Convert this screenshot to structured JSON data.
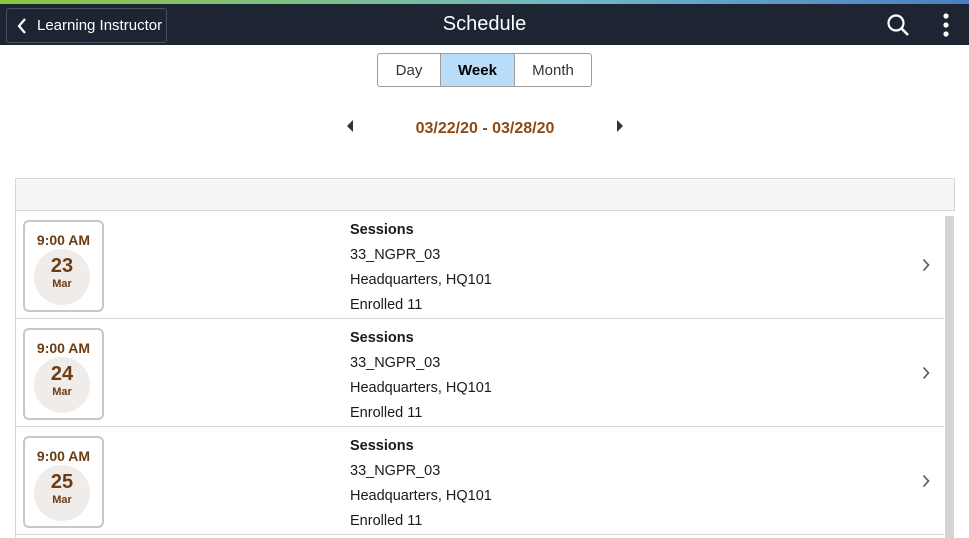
{
  "header": {
    "back_label": "Learning Instructor",
    "title": "Schedule"
  },
  "view_toggle": {
    "day": "Day",
    "week": "Week",
    "month": "Month",
    "selected": "Week"
  },
  "date_range": "03/22/20 - 03/28/20",
  "sessions": [
    {
      "time": "9:00 AM",
      "day": "23",
      "month": "Mar",
      "type": "Sessions",
      "code": "33_NGPR_03",
      "location": "Headquarters, HQ101",
      "enrolled": "Enrolled 11"
    },
    {
      "time": "9:00 AM",
      "day": "24",
      "month": "Mar",
      "type": "Sessions",
      "code": "33_NGPR_03",
      "location": "Headquarters, HQ101",
      "enrolled": "Enrolled 11"
    },
    {
      "time": "9:00 AM",
      "day": "25",
      "month": "Mar",
      "type": "Sessions",
      "code": "33_NGPR_03",
      "location": "Headquarters, HQ101",
      "enrolled": "Enrolled 11"
    }
  ],
  "colors": {
    "header_bg": "#1d2532",
    "selected_tab_bg": "#b9dcf8",
    "date_accent": "#8b4a16"
  },
  "icons": [
    "chevron-left-icon",
    "search-icon",
    "kebab-menu-icon",
    "triangle-left-icon",
    "triangle-right-icon",
    "chevron-right-icon"
  ]
}
